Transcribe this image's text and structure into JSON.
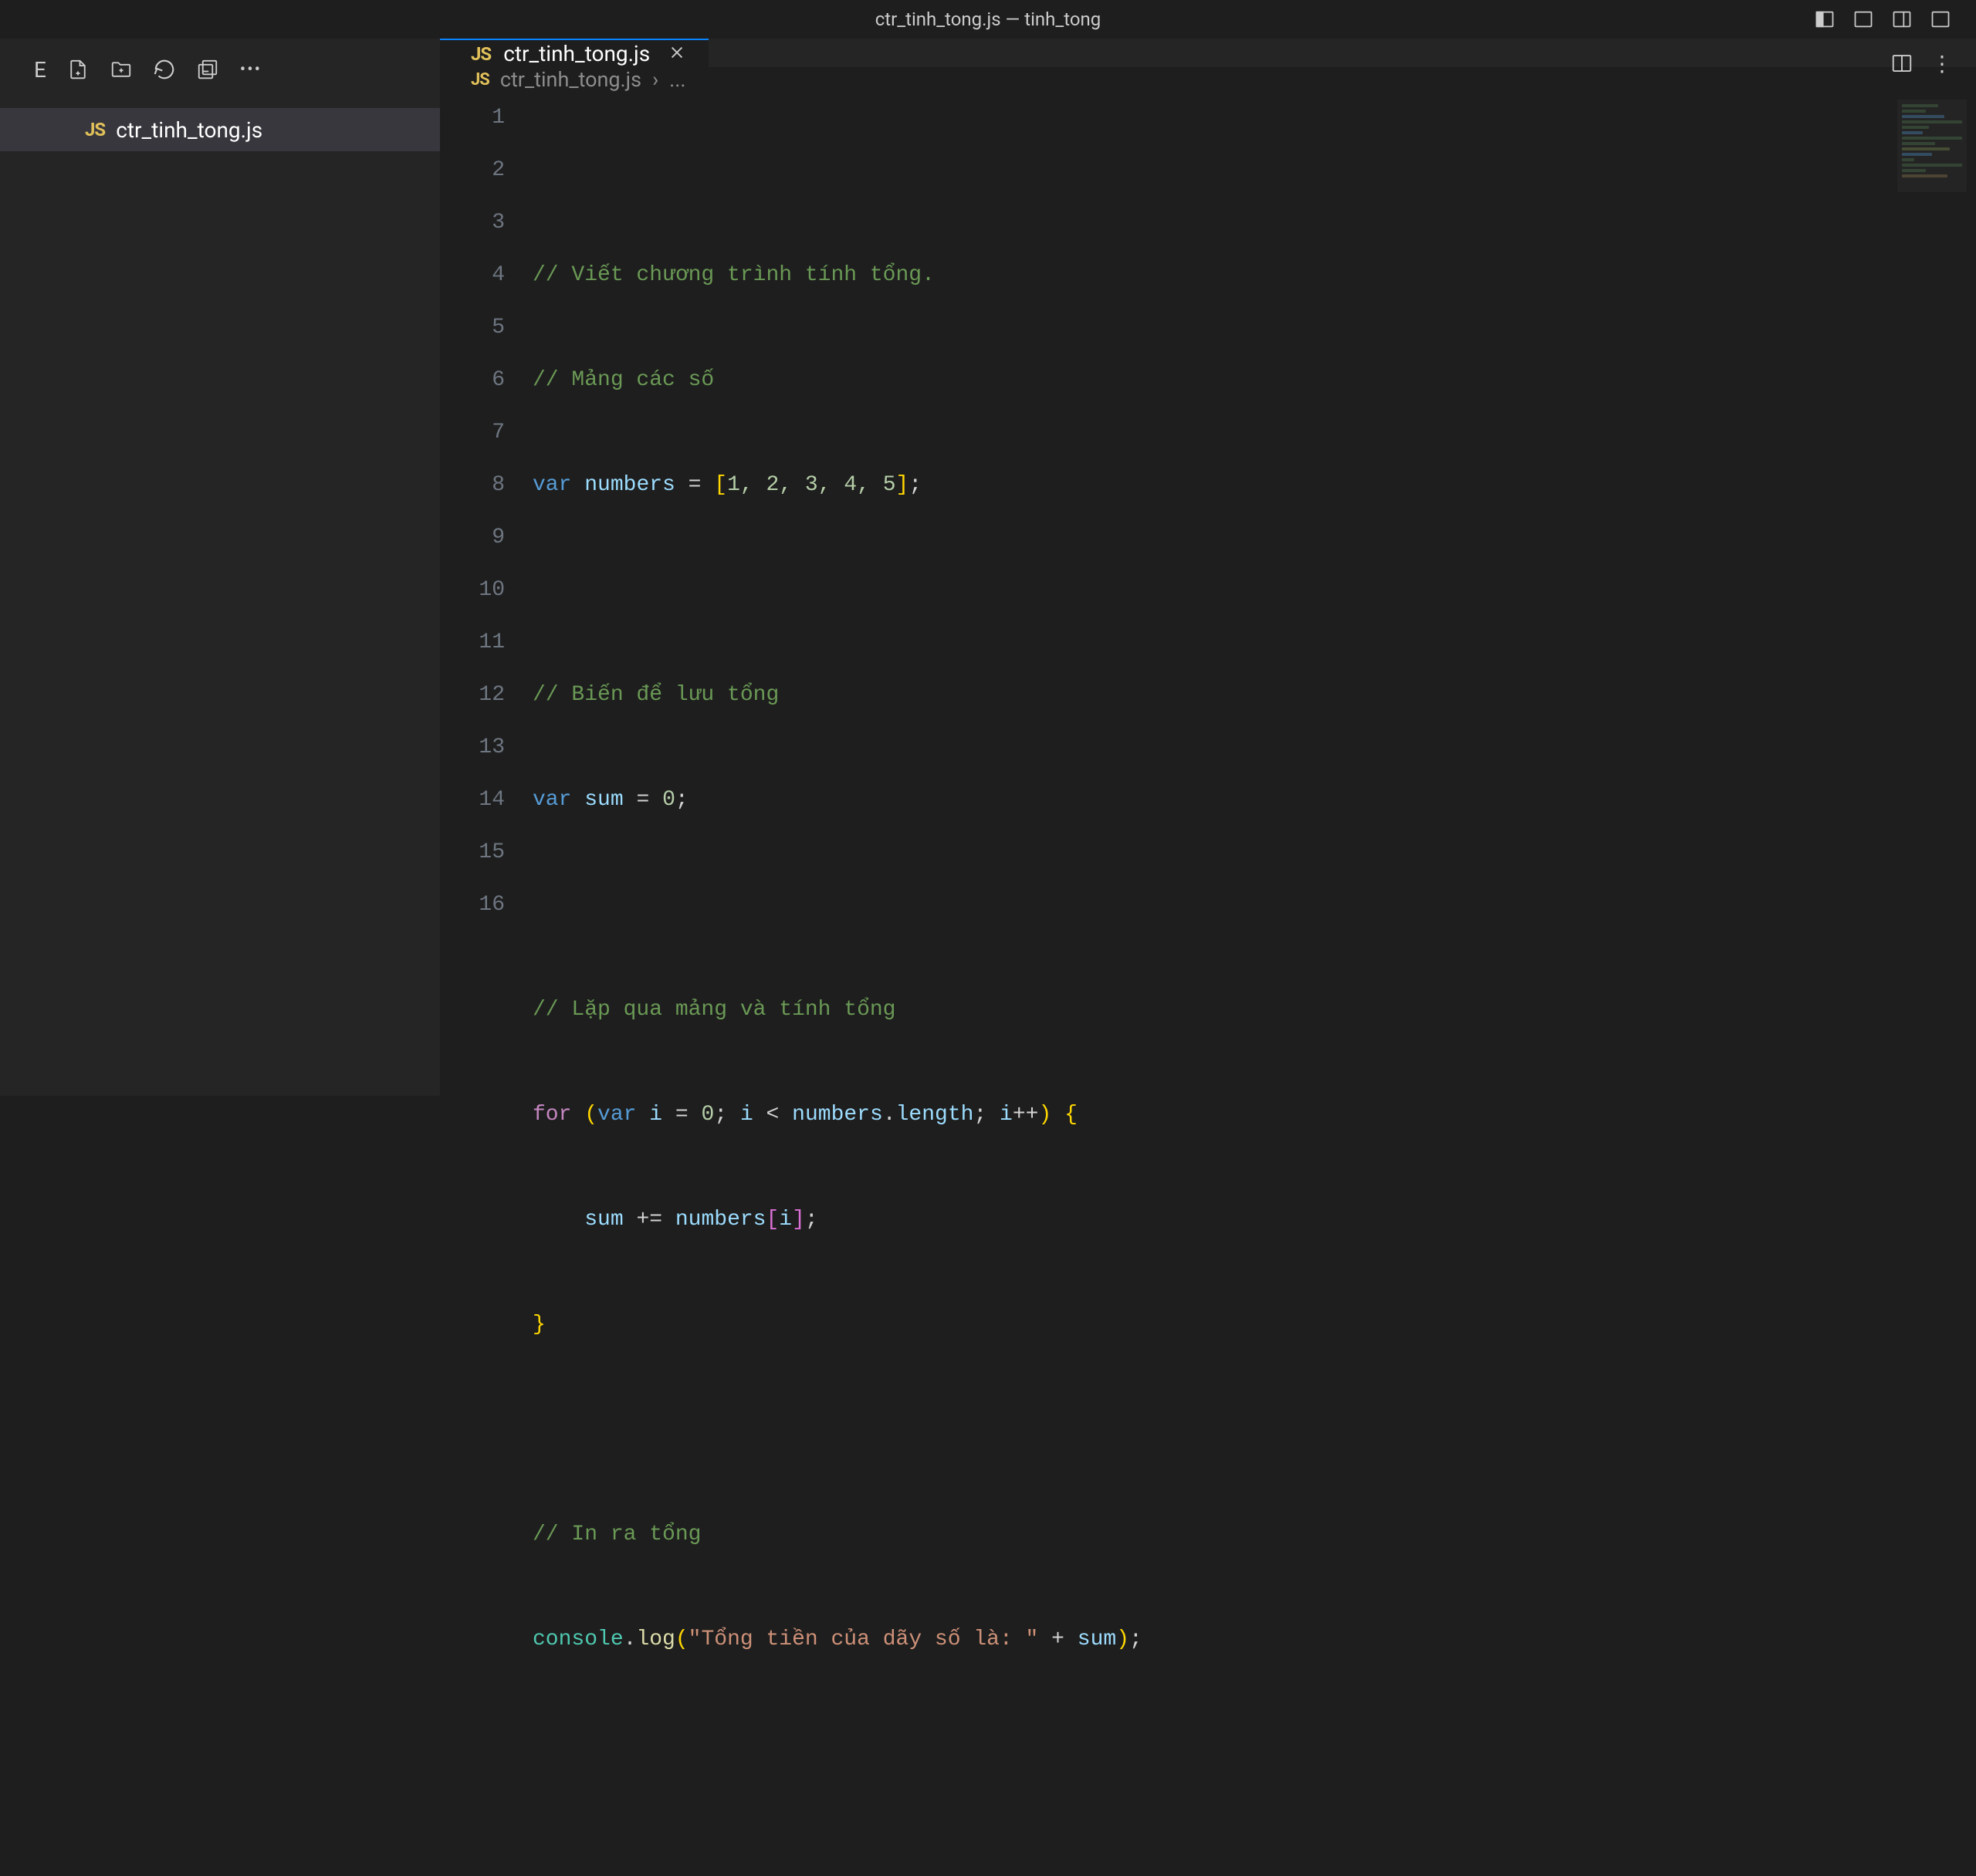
{
  "titlebar": {
    "title": "ctr_tinh_tong.js — tinh_tong"
  },
  "sidebar": {
    "explorer_prefix": "E",
    "file_item": {
      "icon": "JS",
      "name": "ctr_tinh_tong.js"
    }
  },
  "tabs": {
    "active": {
      "icon": "JS",
      "label": "ctr_tinh_tong.js"
    }
  },
  "breadcrumb": {
    "icon": "JS",
    "file": "ctr_tinh_tong.js",
    "sep": "›",
    "tail": "..."
  },
  "code": {
    "line_numbers": [
      "1",
      "2",
      "3",
      "4",
      "5",
      "6",
      "7",
      "8",
      "9",
      "10",
      "11",
      "12",
      "13",
      "14",
      "15",
      "16"
    ],
    "l2": "// Viết chương trình tính tổng.",
    "l3": "// Mảng các số",
    "l4": {
      "kw": "var",
      "name": "numbers",
      "eq": " = ",
      "lb": "[",
      "vals": "1, 2, 3, 4, 5",
      "rb": "]",
      "semi": ";"
    },
    "l6": "// Biến để lưu tổng",
    "l7": {
      "kw": "var",
      "name": "sum",
      "eq": " = ",
      "val": "0",
      "semi": ";"
    },
    "l9": "// Lặp qua mảng và tính tổng",
    "l10": {
      "for": "for",
      "sp": " ",
      "po": "(",
      "kw": "var",
      "i": "i",
      "eq": " = ",
      "zero": "0",
      "semi1": "; ",
      "i2": "i",
      "lt": " < ",
      "num": "numbers",
      "dot": ".",
      "len": "length",
      "semi2": "; ",
      "i3": "i",
      "pp": "++",
      "pc": ")",
      "sp2": " ",
      "ob": "{"
    },
    "l11": {
      "indent": "    ",
      "sum": "sum",
      "op": " += ",
      "num": "numbers",
      "lb": "[",
      "i": "i",
      "rb": "]",
      "semi": ";"
    },
    "l12": {
      "cb": "}"
    },
    "l14": "// In ra tổng",
    "l15": {
      "obj": "console",
      "dot": ".",
      "fn": "log",
      "po": "(",
      "str": "\"Tổng tiền của dãy số là: \"",
      "plus": " + ",
      "sum": "sum",
      "pc": ")",
      "semi": ";"
    }
  }
}
